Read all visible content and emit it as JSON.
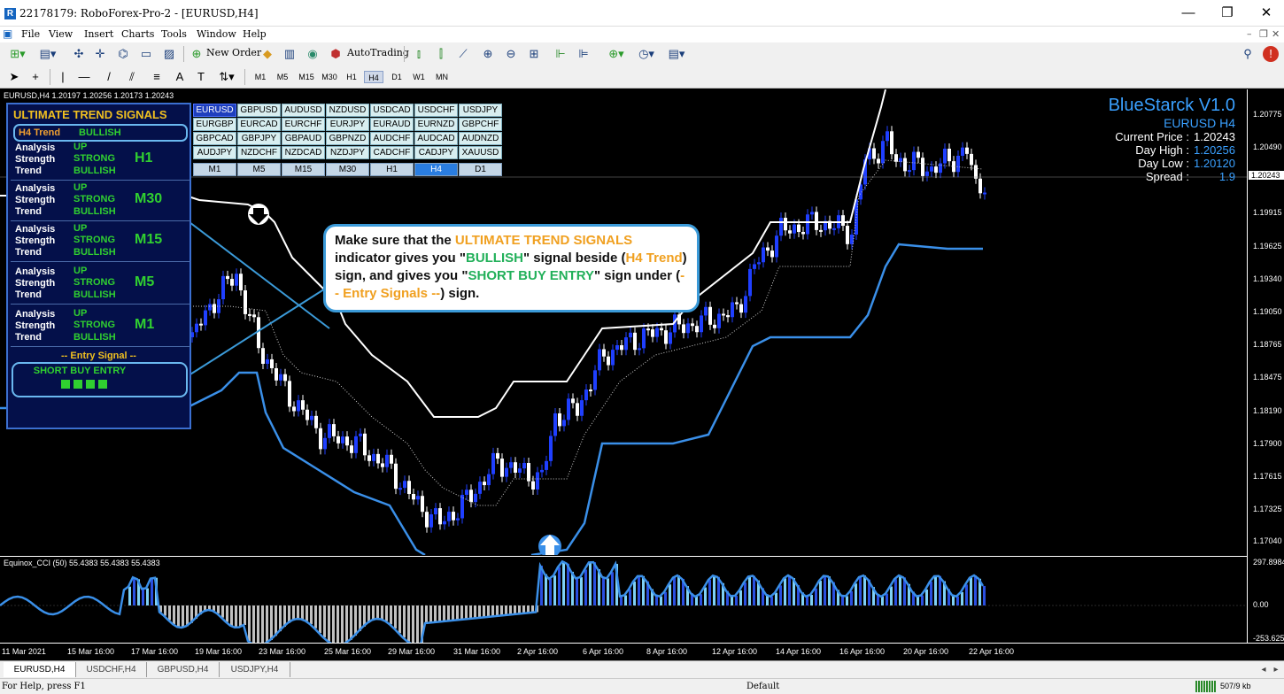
{
  "window": {
    "title": "22178179: RoboForex-Pro-2 - [EURUSD,H4]",
    "buttons": [
      "—",
      "❐",
      "✕"
    ]
  },
  "menu": [
    "File",
    "View",
    "Insert",
    "Charts",
    "Tools",
    "Window",
    "Help"
  ],
  "toolbar": {
    "new_order_label": "New Order",
    "autotrading_label": "AutoTrading"
  },
  "timeframes": [
    "M1",
    "M5",
    "M15",
    "M30",
    "H1",
    "H4",
    "D1",
    "W1",
    "MN"
  ],
  "active_timeframe": "H4",
  "chart": {
    "header": "EURUSD,H4  1.20197 1.20256 1.20173 1.20243",
    "price_labels": [
      "1.20775",
      "1.20490",
      "1.20243",
      "1.19915",
      "1.19625",
      "1.19340",
      "1.19050",
      "1.18765",
      "1.18475",
      "1.18190",
      "1.17900",
      "1.17615",
      "1.17325",
      "1.17040"
    ],
    "current_price": "1.20243",
    "cci_header": "Equinox_CCI (50) 55.4383 55.4383 55.4383",
    "cci_labels": [
      "297.8984",
      "0.00",
      "-253.6255"
    ],
    "time_labels": [
      "11 Mar 2021",
      "15 Mar 16:00",
      "17 Mar 16:00",
      "19 Mar 16:00",
      "23 Mar 16:00",
      "25 Mar 16:00",
      "29 Mar 16:00",
      "31 Mar 16:00",
      "2 Apr 16:00",
      "6 Apr 16:00",
      "8 Apr 16:00",
      "12 Apr 16:00",
      "14 Apr 16:00",
      "16 Apr 16:00",
      "20 Apr 16:00",
      "22 Apr 16:00"
    ]
  },
  "uts": {
    "title": "ULTIMATE TREND SIGNALS",
    "h4_label": "H4 Trend",
    "h4_value": "BULLISH",
    "groups": [
      {
        "tf": "H1",
        "analysis": "UP",
        "strength": "STRONG",
        "trend": "BULLISH"
      },
      {
        "tf": "M30",
        "analysis": "UP",
        "strength": "STRONG",
        "trend": "BULLISH"
      },
      {
        "tf": "M15",
        "analysis": "UP",
        "strength": "STRONG",
        "trend": "BULLISH"
      },
      {
        "tf": "M5",
        "analysis": "UP",
        "strength": "STRONG",
        "trend": "BULLISH"
      },
      {
        "tf": "M1",
        "analysis": "UP",
        "strength": "STRONG",
        "trend": "BULLISH"
      }
    ],
    "row_labels": {
      "analysis": "Analysis",
      "strength": "Strength",
      "trend": "Trend"
    },
    "entry_head": "-- Entry Signal --",
    "entry_text": "SHORT BUY ENTRY"
  },
  "pairs": [
    [
      "EURUSD",
      "GBPUSD",
      "AUDUSD",
      "NZDUSD",
      "USDCAD",
      "USDCHF",
      "USDJPY"
    ],
    [
      "EURGBP",
      "EURCAD",
      "EURCHF",
      "EURJPY",
      "EURAUD",
      "EURNZD",
      "GBPCHF"
    ],
    [
      "GBPCAD",
      "GBPJPY",
      "GBPAUD",
      "GBPNZD",
      "AUDCHF",
      "AUDCAD",
      "AUDNZD"
    ],
    [
      "AUDJPY",
      "NZDCHF",
      "NZDCAD",
      "NZDJPY",
      "CADCHF",
      "CADJPY",
      "XAUUSD"
    ]
  ],
  "active_pair": "EURUSD",
  "pair_timeframes": [
    "M1",
    "M5",
    "M15",
    "M30",
    "H1",
    "H4",
    "D1"
  ],
  "active_pair_tf": "H4",
  "bluestarck": {
    "title": "BlueStarck V1.0",
    "pair": "EURUSD H4",
    "current_price_label": "Current Price :",
    "current_price": "1.20243",
    "day_high_label": "Day High :",
    "day_high": "1.20256",
    "day_low_label": "Day Low :",
    "day_low": "1.20120",
    "spread_label": "Spread :",
    "spread": "1.9"
  },
  "callout": {
    "p1": "Make sure that the ",
    "p2": "ULTIMATE TREND SIGNALS",
    "p3": " indicator gives you \"",
    "p4": "BULLISH",
    "p5": "\" signal beside (",
    "p6": "H4 Trend",
    "p7": ") sign, and gives you \"",
    "p8": "SHORT BUY ENTRY",
    "p9": "\" sign under (",
    "p10": "-- Entry Signals --",
    "p11": ") sign."
  },
  "tabs": [
    "EURUSD,H4",
    "USDCHF,H4",
    "GBPUSD,H4",
    "USDJPY,H4"
  ],
  "status": {
    "help": "For Help, press F1",
    "profile": "Default",
    "traffic": "507/9 kb"
  },
  "colors": {
    "bull": "#1f3fff",
    "bear": "#ffffff",
    "band_upper": "#ffffff",
    "band_lower": "#3a8fe8",
    "cci_up": "#2a4fe0",
    "cci_up_light": "#7fd0f5",
    "cci_down": "#c0c0c0"
  }
}
